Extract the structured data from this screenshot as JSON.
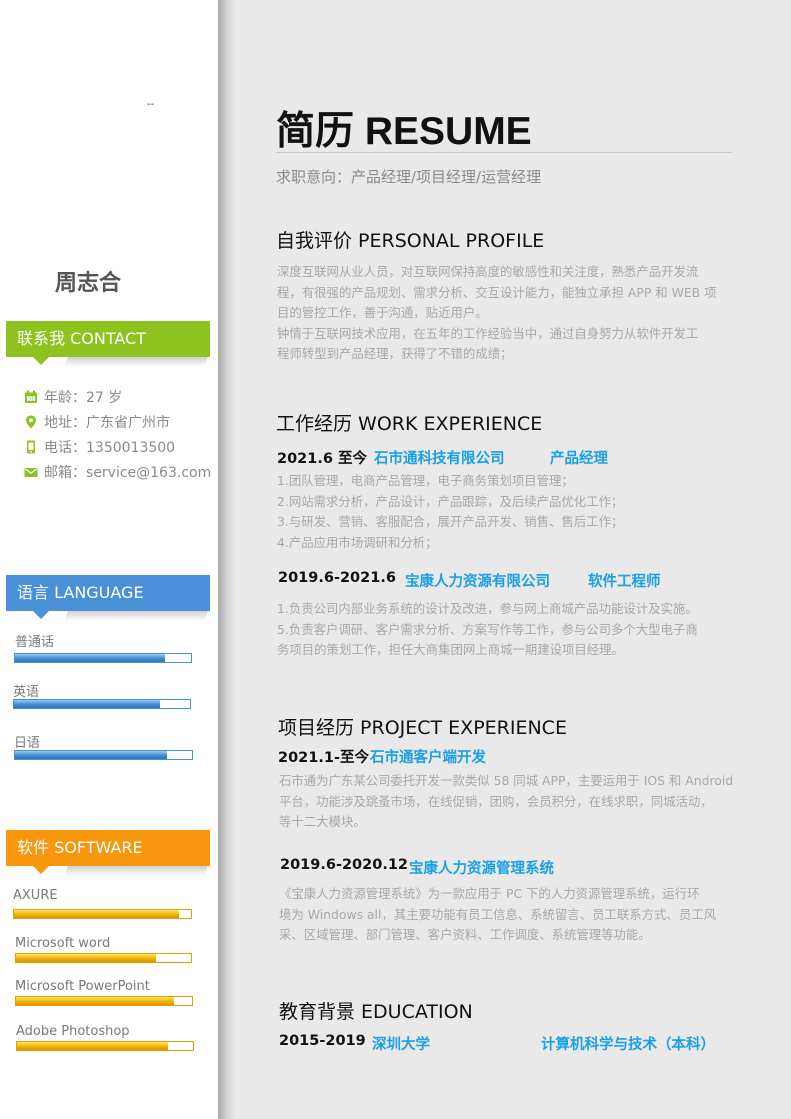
{
  "sidebar": {
    "mark": "--",
    "name": "周志合",
    "contact": {
      "heading": "联系我 CONTACT",
      "items": [
        {
          "icon": "calendar-icon",
          "text": "年龄：27 岁"
        },
        {
          "icon": "location-pin-icon",
          "text": "地址：广东省广州市"
        },
        {
          "icon": "phone-icon",
          "text": "电话：1350013500"
        },
        {
          "icon": "mail-icon",
          "text": "邮箱：service@163.com"
        }
      ]
    },
    "language": {
      "heading": "语言 LANGUAGE",
      "items": [
        {
          "label": "普通话",
          "level": 0.85
        },
        {
          "label": "英语",
          "level": 0.83
        },
        {
          "label": "日语",
          "level": 0.86
        }
      ]
    },
    "software": {
      "heading": "软件 SOFTWARE",
      "items": [
        {
          "label": "AXURE",
          "level": 0.93
        },
        {
          "label": "Microsoft word",
          "level": 0.8
        },
        {
          "label": "Microsoft PowerPoint",
          "level": 0.9
        },
        {
          "label": "Adobe Photoshop",
          "level": 0.86
        }
      ]
    },
    "colors": {
      "contact": "#8dc21f",
      "language": "#4a90d9",
      "software": "#f8960e"
    }
  },
  "main": {
    "title": "简历  RESUME",
    "job_intent": "求职意向：产品经理/项目经理/运营经理",
    "profile": {
      "heading": "自我评价  PERSONAL PROFILE",
      "lines": [
        "深度互联网从业人员，对互联网保持高度的敏感性和关注度，熟悉产品开发流",
        "程，有很强的产品规划、需求分析、交互设计能力，能独立承担 APP 和 WEB 项",
        "目的管控工作，善于沟通，贴近用户。",
        "钟情于互联网技术应用，在五年的工作经验当中，通过自身努力从软件开发工",
        "程师转型到产品经理，获得了不错的成绩；"
      ]
    },
    "work": {
      "heading": "工作经历  WORK EXPERIENCE",
      "jobs": [
        {
          "date": "2021.6 至今",
          "company": "石市通科技有限公司",
          "role": "产品经理",
          "lines": [
            "1.团队管理，电商产品管理，电子商务策划项目管理；",
            "2.网站需求分析，产品设计，产品跟踪，及后续产品优化工作；",
            "3.与研发、营销、客服配合，展开产品开发、销售、售后工作；",
            "4.产品应用市场调研和分析；"
          ]
        },
        {
          "date": "2019.6-2021.6",
          "company": "宝康人力资源有限公司",
          "role": "软件工程师",
          "lines": [
            "1.负责公司内部业务系统的设计及改进，参与网上商城产品功能设计及实施。",
            "5.负责客户调研、客户需求分析、方案写作等工作，参与公司多个大型电子商",
            "务项目的策划工作，担任大商集团网上商城一期建设项目经理。"
          ]
        }
      ]
    },
    "projects": {
      "heading": "项目经历  PROJECT EXPERIENCE",
      "items": [
        {
          "date": "2021.1-至今",
          "name": "石市通客户端开发",
          "lines": [
            "石市通为广东某公司委托开发一款类似 58 同城 APP，主要运用于 IOS 和 Android",
            "平台，功能涉及跳蚤市场，在线促销，团购，会员积分，在线求职，同城活动，",
            "等十二大模块。"
          ]
        },
        {
          "date": "2019.6-2020.12",
          "name": "宝康人力资源管理系统",
          "lines": [
            "《宝康人力资源管理系统》为一款应用于 PC 下的人力资源管理系统，运行环",
            "境为 Windows all，其主要功能有员工信息、系统留言、员工联系方式、员工风",
            "采、区域管理、部门管理、客户资料、工作调度、系统管理等功能。"
          ]
        }
      ]
    },
    "education": {
      "heading": "教育背景  EDUCATION",
      "date": "2015-2019",
      "school": "深圳大学",
      "major": "计算机科学与技术（本科）"
    }
  }
}
